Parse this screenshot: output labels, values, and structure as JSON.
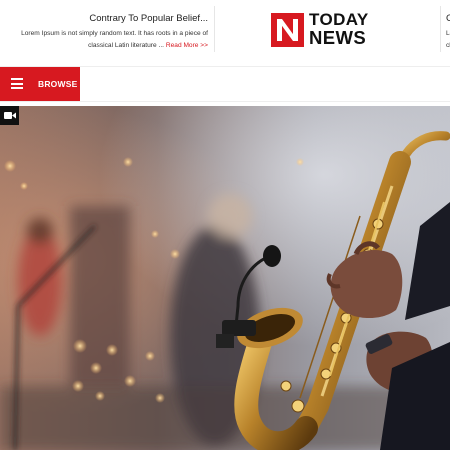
{
  "header": {
    "left_teaser": {
      "title": "Contrary To Popular Belief...",
      "body": "Lorem Ipsum is not simply random text. It has roots in a piece of classical Latin literature ...",
      "read_more": "Read More >>"
    },
    "logo": {
      "mark": "N",
      "word_top": "TODAY",
      "word_bottom": "NEWS"
    },
    "right_teaser": {
      "title": "C",
      "body_line1": "Lo",
      "body_line2": "cl"
    }
  },
  "nav": {
    "browse_label": "BROWSE",
    "menu_icon": "hamburger-menu-icon"
  },
  "hero": {
    "badge_icon": "video-camera-icon",
    "image_subject": "saxophone-player-photo"
  },
  "colors": {
    "brand_red": "#d71920",
    "text_dark": "#111111",
    "divider": "#e6e6e6"
  }
}
